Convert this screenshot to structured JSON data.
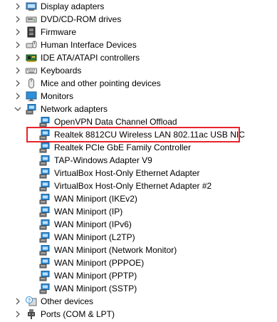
{
  "categories_top": [
    {
      "label": "Display adapters",
      "icon": "display-adapter-icon",
      "expanded": false
    },
    {
      "label": "DVD/CD-ROM drives",
      "icon": "dvd-drive-icon",
      "expanded": false
    },
    {
      "label": "Firmware",
      "icon": "firmware-icon",
      "expanded": false
    },
    {
      "label": "Human Interface Devices",
      "icon": "hid-icon",
      "expanded": false
    },
    {
      "label": "IDE ATA/ATAPI controllers",
      "icon": "ide-controller-icon",
      "expanded": false
    },
    {
      "label": "Keyboards",
      "icon": "keyboard-icon",
      "expanded": false
    },
    {
      "label": "Mice and other pointing devices",
      "icon": "mouse-icon",
      "expanded": false
    },
    {
      "label": "Monitors",
      "icon": "monitor-icon",
      "expanded": false
    },
    {
      "label": "Network adapters",
      "icon": "network-adapter-icon",
      "expanded": true
    }
  ],
  "network_adapters": [
    {
      "label": "OpenVPN Data Channel Offload",
      "icon": "network-adapter-icon"
    },
    {
      "label": "Realtek 8812CU Wireless LAN 802.11ac USB NIC",
      "icon": "network-adapter-icon",
      "highlighted": true
    },
    {
      "label": "Realtek PCIe GbE Family Controller",
      "icon": "network-adapter-icon"
    },
    {
      "label": "TAP-Windows Adapter V9",
      "icon": "network-adapter-icon"
    },
    {
      "label": "VirtualBox Host-Only Ethernet Adapter",
      "icon": "network-adapter-icon"
    },
    {
      "label": "VirtualBox Host-Only Ethernet Adapter #2",
      "icon": "network-adapter-icon"
    },
    {
      "label": "WAN Miniport (IKEv2)",
      "icon": "network-adapter-icon"
    },
    {
      "label": "WAN Miniport (IP)",
      "icon": "network-adapter-icon"
    },
    {
      "label": "WAN Miniport (IPv6)",
      "icon": "network-adapter-icon"
    },
    {
      "label": "WAN Miniport (L2TP)",
      "icon": "network-adapter-icon"
    },
    {
      "label": "WAN Miniport (Network Monitor)",
      "icon": "network-adapter-icon"
    },
    {
      "label": "WAN Miniport (PPPOE)",
      "icon": "network-adapter-icon"
    },
    {
      "label": "WAN Miniport (PPTP)",
      "icon": "network-adapter-icon"
    },
    {
      "label": "WAN Miniport (SSTP)",
      "icon": "network-adapter-icon"
    }
  ],
  "categories_bottom": [
    {
      "label": "Other devices",
      "icon": "other-devices-icon",
      "expanded": false
    },
    {
      "label": "Ports (COM & LPT)",
      "icon": "ports-icon",
      "expanded": false
    }
  ],
  "colors": {
    "highlight_border": "#e8232b",
    "chevron": "#5a5a5a",
    "network_icon_blue": "#2f8fd8"
  }
}
